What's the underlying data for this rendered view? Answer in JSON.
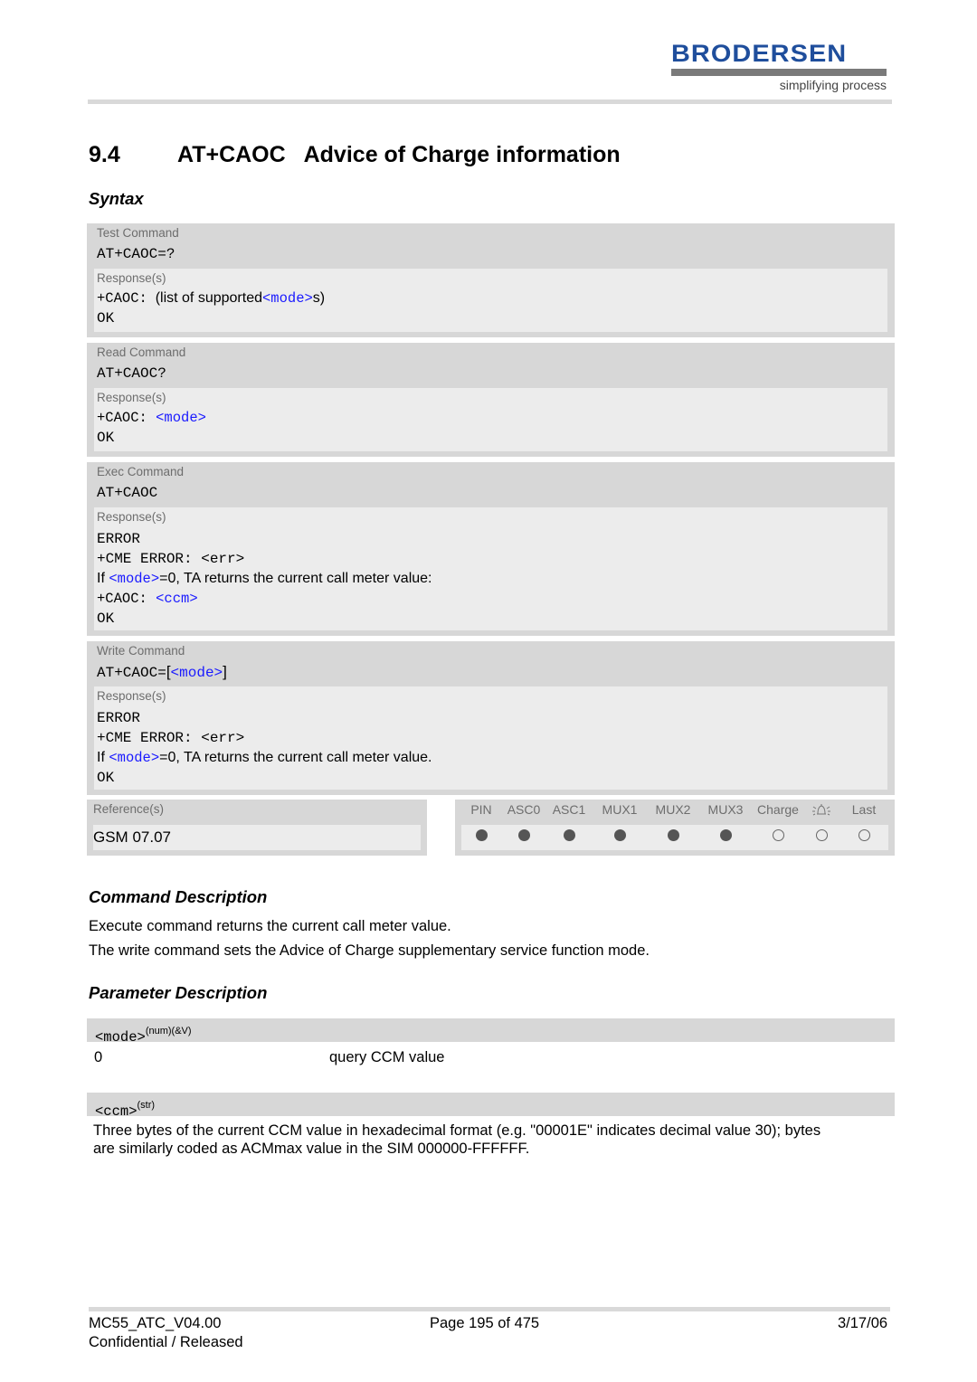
{
  "header": {
    "brand": "BRODERSEN",
    "tagline": "simplifying process",
    "brand_color": "#1f4e9c"
  },
  "section": {
    "number": "9.4",
    "command": "AT+CAOC",
    "title": "Advice of Charge information"
  },
  "syntax_heading": "Syntax",
  "commands": {
    "test": {
      "label": "Test Command",
      "syntax": "AT+CAOC=?",
      "response_label": "Response(s)",
      "r1_prefix": "+CAOC:",
      "r1_text_a": "  (list of supported",
      "r1_param": "<mode>",
      "r1_text_b": "s)",
      "r2": "OK"
    },
    "read": {
      "label": "Read Command",
      "syntax": "AT+CAOC?",
      "response_label": "Response(s)",
      "r1_prefix": "+CAOC: ",
      "r1_param": "<mode>",
      "r2": "OK"
    },
    "exec": {
      "label": "Exec Command",
      "syntax": "AT+CAOC",
      "response_label": "Response(s)",
      "r1": "ERROR",
      "r2": "+CME ERROR: <err>",
      "r3_a": "If ",
      "r3_param": "<mode>",
      "r3_b": "=0, TA returns the current call meter value:",
      "r4_prefix": "+CAOC: ",
      "r4_param": "<ccm>",
      "r5": "OK"
    },
    "write": {
      "label": "Write Command",
      "syntax_prefix": "AT+CAOC=",
      "syntax_open": "[",
      "syntax_param": "<mode>",
      "syntax_close": "]",
      "response_label": "Response(s)",
      "r1": "ERROR",
      "r2": "+CME ERROR: <err>",
      "r3_a": "If ",
      "r3_param": "<mode>",
      "r3_b": "=0, TA returns the current call meter value.",
      "r4": "OK"
    }
  },
  "references": {
    "label": "Reference(s)",
    "value": "GSM 07.07"
  },
  "flags": {
    "columns": [
      {
        "label": "PIN",
        "supported": true
      },
      {
        "label": "ASC0",
        "supported": true
      },
      {
        "label": "ASC1",
        "supported": true
      },
      {
        "label": "MUX1",
        "supported": true
      },
      {
        "label": "MUX2",
        "supported": true
      },
      {
        "label": "MUX3",
        "supported": true
      },
      {
        "label": "Charge",
        "supported": false
      },
      {
        "label": "alarm-bell-icon",
        "supported": false
      },
      {
        "label": "Last",
        "supported": false
      }
    ]
  },
  "command_description": {
    "heading": "Command Description",
    "lines": [
      "Execute command returns the current call meter value.",
      "The write command sets the Advice of Charge supplementary service function mode."
    ]
  },
  "parameter_description": {
    "heading": "Parameter Description",
    "mode": {
      "name": "<mode>",
      "attrs": "(num)(&V)",
      "values": [
        {
          "value": "0",
          "description": "query CCM value"
        }
      ]
    },
    "ccm": {
      "name": "<ccm>",
      "attrs": "(str)",
      "desc_line1": "Three bytes of the current CCM value in hexadecimal format (e.g. \"00001E\" indicates decimal value 30); bytes",
      "desc_line2": "are similarly coded as ACMmax value in the SIM 000000-FFFFFF."
    }
  },
  "footer": {
    "doc_id": "MC55_ATC_V04.00",
    "page": "Page 195 of 475",
    "date": "3/17/06",
    "status": "Confidential / Released"
  }
}
